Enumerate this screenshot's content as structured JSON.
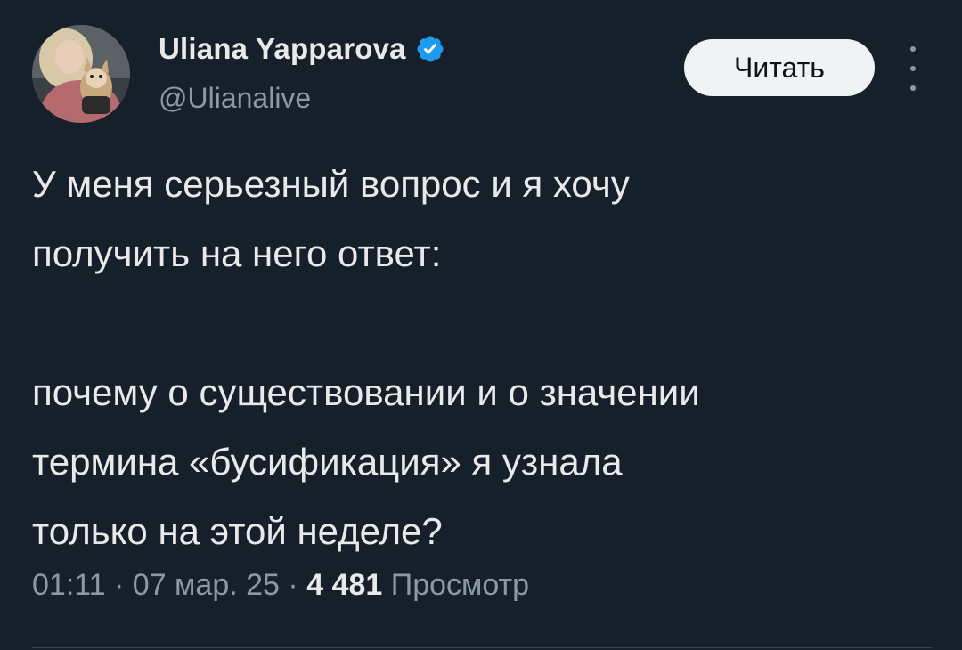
{
  "author": {
    "display_name": "Uliana Yapparova",
    "handle": "@Ulianalive",
    "verified": true,
    "avatar_icon": "avatar-photo-with-dog"
  },
  "follow_button": {
    "label": "Читать"
  },
  "more_icon": "more-vertical-icon",
  "tweet": {
    "paragraph_1_line_1": "У меня серьезный вопрос и я хочу",
    "paragraph_1_line_2": "получить на него ответ:",
    "paragraph_2_line_1": "почему о существовании и о значении",
    "paragraph_2_line_2": "термина «бусификация» я узнала",
    "paragraph_2_line_3": "только на этой неделе?"
  },
  "meta": {
    "time": "01:11",
    "separator": "·",
    "date": "07 мар. 25",
    "views_count": "4 481",
    "views_label": "Просмотр"
  },
  "colors": {
    "background": "#15202b",
    "text": "#e7e9ea",
    "secondary": "#8b98a5",
    "verified": "#1d9bf0",
    "button_bg": "#eff3f4"
  }
}
